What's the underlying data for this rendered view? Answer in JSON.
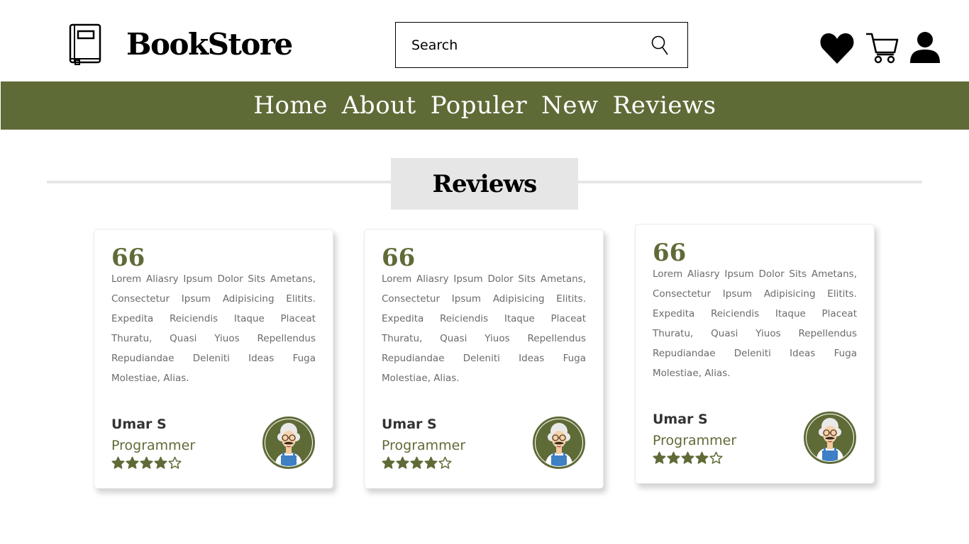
{
  "header": {
    "brand": "BookStore",
    "search": {
      "placeholder": "Search",
      "value": ""
    },
    "icons": [
      "book-icon",
      "search-icon",
      "heart-icon",
      "cart-icon",
      "user-icon"
    ]
  },
  "nav": {
    "items": [
      "Home",
      "About",
      "Populer",
      "New",
      "Reviews"
    ]
  },
  "section": {
    "title": "Reviews"
  },
  "reviews": [
    {
      "quote": "66",
      "text": "Lorem Aliasry Ipsum Dolor Sits Ametans, Consectetur Ipsum Adipisicing Elitits. Expedita Reiciendis Itaque Placeat Thuratu, Quasi Yiuos Repellendus Repudiandae Deleniti Ideas Fuga Molestiae, Alias.",
      "name": "Umar S",
      "role": "Programmer",
      "rating": 4,
      "max_rating": 5
    },
    {
      "quote": "66",
      "text": "Lorem Aliasry Ipsum Dolor Sits Ametans, Consectetur Ipsum Adipisicing Elitits. Expedita Reiciendis Itaque Placeat Thuratu, Quasi Yiuos Repellendus Repudiandae Deleniti Ideas Fuga Molestiae, Alias.",
      "name": "Umar S",
      "role": "Programmer",
      "rating": 4,
      "max_rating": 5
    },
    {
      "quote": "66",
      "text": "Lorem Aliasry Ipsum Dolor Sits Ametans, Consectetur Ipsum Adipisicing Elitits. Expedita Reiciendis Itaque Placeat Thuratu, Quasi Yiuos Repellendus Repudiandae Deleniti Ideas Fuga Molestiae, Alias.",
      "name": "Umar S",
      "role": "Programmer",
      "rating": 4,
      "max_rating": 5
    }
  ],
  "colors": {
    "accent": "#5f6b37",
    "heading_bg": "#e6e6e6",
    "text_muted": "#6b6b6b",
    "name_text": "#333333"
  }
}
